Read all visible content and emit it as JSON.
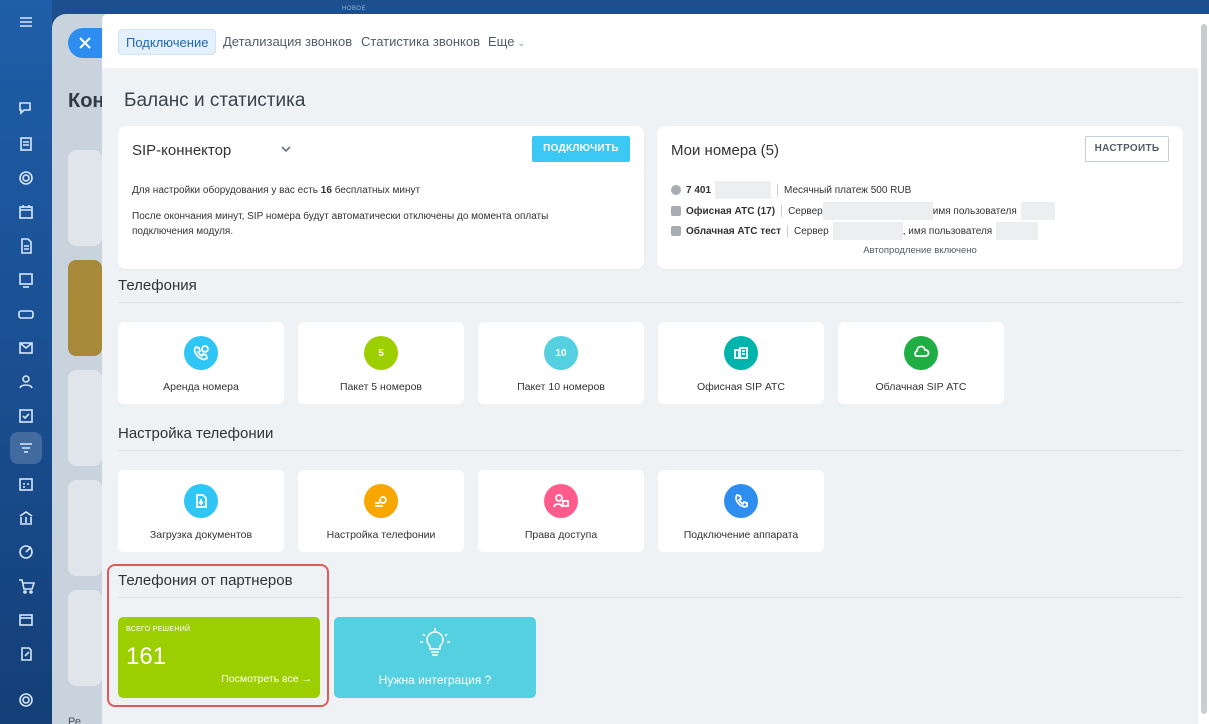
{
  "app": {
    "under_title": "Кон",
    "under_tag": "НОВОЕ",
    "under_bottom_text": "Ре"
  },
  "tabs": [
    {
      "label": "Подключение",
      "active": true
    },
    {
      "label": "Детализация звонков",
      "active": false
    },
    {
      "label": "Статистика звонков",
      "active": false
    },
    {
      "label": "Еще",
      "active": false
    }
  ],
  "page_title": "Баланс и статистика",
  "sip": {
    "title": "SIP-коннектор",
    "connect_button": "ПОДКЛЮЧИТЬ",
    "line1_prefix": "Для настройки оборудования у вас есть ",
    "line1_count": "16",
    "line1_suffix": " бесплатных минут",
    "line2": "После окончания минут, SIP номера будут автоматически отключены до момента оплаты",
    "line3": "подключения модуля."
  },
  "numbers": {
    "title": "Мои номера (5)",
    "configure_button": "НАСТРОИТЬ",
    "row1_number": "7 401",
    "row1_text": "Месячный платеж 500 RUB",
    "row2_name": "Офисная АТС (17)",
    "row2_server": "Сервер",
    "row2_user": "имя пользователя",
    "row3_name": "Облачная АТС тест",
    "row3_server": "Сервер",
    "row3_user": ", имя пользователя",
    "autorenew": "Автопродление включено"
  },
  "telephony": {
    "title": "Телефония",
    "tiles": [
      {
        "label": "Аренда номера",
        "icon": "phone-rent-icon",
        "color": "#2fc6f6"
      },
      {
        "label": "Пакет 5 номеров",
        "icon": "package-5-icon",
        "color": "#9dcf00",
        "glyph": "5"
      },
      {
        "label": "Пакет 10 номеров",
        "icon": "package-10-icon",
        "color": "#55d0e0",
        "glyph": "10"
      },
      {
        "label": "Офисная SIP АТС",
        "icon": "office-pbx-icon",
        "color": "#00b4ac"
      },
      {
        "label": "Облачная SIP АТС",
        "icon": "cloud-pbx-icon",
        "color": "#1eae43"
      }
    ]
  },
  "settings": {
    "title": "Настройка телефонии",
    "tiles": [
      {
        "label": "Загрузка документов",
        "icon": "document-upload-icon",
        "color": "#2fc6f6"
      },
      {
        "label": "Настройка телефонии",
        "icon": "telephony-settings-icon",
        "color": "#f7a700"
      },
      {
        "label": "Права доступа",
        "icon": "access-rights-icon",
        "color": "#ff5c8d"
      },
      {
        "label": "Подключение аппарата",
        "icon": "device-connect-icon",
        "color": "#2d8ef0"
      }
    ]
  },
  "partners": {
    "title": "Телефония от партнеров",
    "total_caption": "ВСЕГО РЕШЕНИЙ",
    "total_count": "161",
    "view_all": "Посмотреть все →",
    "integration": "Нужна интеграция ?"
  },
  "colors": {
    "accent": "#3bc8f5",
    "sidebar": "#1f5ea8",
    "highlight": "#e05a5a"
  }
}
